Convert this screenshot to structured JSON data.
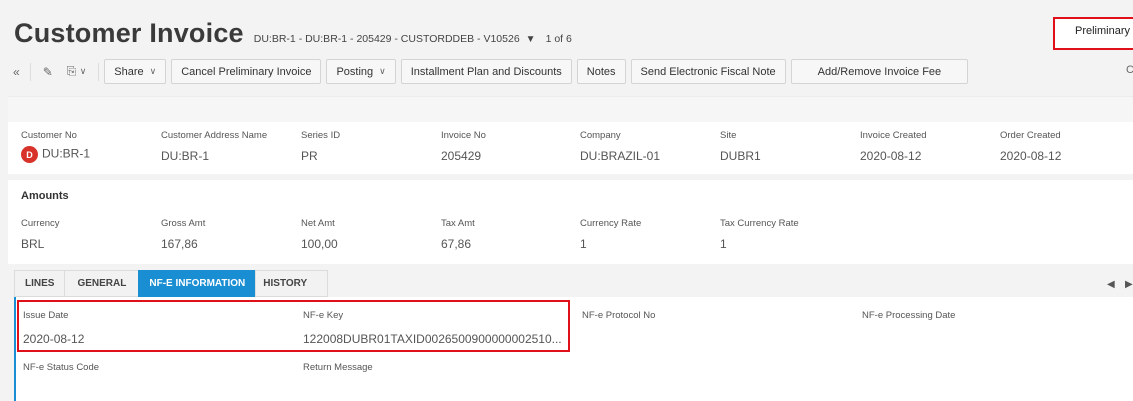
{
  "header": {
    "title": "Customer Invoice",
    "subtitle": "DU:BR-1 - DU:BR-1 - 205429 - CUSTORDDEB - V10526",
    "caret_icon": "caret-down-icon",
    "pager": "1 of 6",
    "status": "Preliminary"
  },
  "toolbar": {
    "share": "Share",
    "cancel_preliminary": "Cancel Preliminary Invoice",
    "posting": "Posting",
    "installment": "Installment Plan and Discounts",
    "notes": "Notes",
    "send_efn": "Send Electronic Fiscal Note",
    "add_remove_fee": "Add/Remove Invoice Fee"
  },
  "fields": {
    "customer_no": {
      "label": "Customer No",
      "value": "DU:BR-1",
      "avatar": "D"
    },
    "customer_address_name": {
      "label": "Customer Address Name",
      "value": "DU:BR-1"
    },
    "series_id": {
      "label": "Series ID",
      "value": "PR"
    },
    "invoice_no": {
      "label": "Invoice No",
      "value": "205429"
    },
    "company": {
      "label": "Company",
      "value": "DU:BRAZIL-01"
    },
    "site": {
      "label": "Site",
      "value": "DUBR1"
    },
    "invoice_created": {
      "label": "Invoice Created",
      "value": "2020-08-12"
    },
    "order_created": {
      "label": "Order Created",
      "value": "2020-08-12"
    }
  },
  "amounts": {
    "title": "Amounts",
    "currency": {
      "label": "Currency",
      "value": "BRL"
    },
    "gross_amt": {
      "label": "Gross Amt",
      "value": "167,86"
    },
    "net_amt": {
      "label": "Net Amt",
      "value": "100,00"
    },
    "tax_amt": {
      "label": "Tax Amt",
      "value": "67,86"
    },
    "currency_rate": {
      "label": "Currency Rate",
      "value": "1"
    },
    "tax_currency_rate": {
      "label": "Tax Currency Rate",
      "value": "1"
    }
  },
  "tabs": [
    {
      "label": "LINES",
      "active": false
    },
    {
      "label": "GENERAL",
      "active": false
    },
    {
      "label": "NF-E INFORMATION",
      "active": true
    },
    {
      "label": "HISTORY",
      "active": false
    }
  ],
  "nfe": {
    "issue_date": {
      "label": "Issue Date",
      "value": "2020-08-12"
    },
    "nfe_key": {
      "label": "NF-e Key",
      "value": "122008DUBR01TAXID0026500900000002510..."
    },
    "protocol_no": {
      "label": "NF-e Protocol No",
      "value": ""
    },
    "processing_date": {
      "label": "NF-e Processing Date",
      "value": ""
    },
    "status_code": {
      "label": "NF-e Status Code",
      "value": ""
    },
    "return_message": {
      "label": "Return Message",
      "value": ""
    }
  },
  "colors": {
    "accent": "#1a8ed3",
    "highlight": "#e0101a",
    "avatar": "#d8332b"
  }
}
